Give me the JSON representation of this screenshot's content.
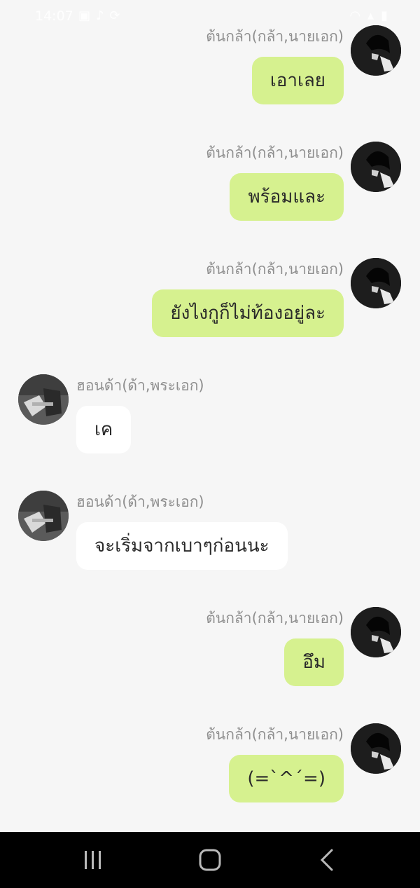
{
  "status_bar": {
    "time": "14:07",
    "icons_left": [
      "image-icon",
      "tiktok-icon",
      "sync-icon"
    ],
    "icons_right": [
      "wifi-icon",
      "signal-icon",
      "battery-icon"
    ]
  },
  "messages": [
    {
      "side": "right",
      "sender": "ต้นกล้า(กล้า,นายเอก)",
      "text": "เอาเลย"
    },
    {
      "side": "right",
      "sender": "ต้นกล้า(กล้า,นายเอก)",
      "text": "พร้อมและ"
    },
    {
      "side": "right",
      "sender": "ต้นกล้า(กล้า,นายเอก)",
      "text": "ยังไงกูก็ไม่ท้องอยู่ละ"
    },
    {
      "side": "left",
      "sender": "ฮอนด้า(ด้า,พระเอก)",
      "text": "เค"
    },
    {
      "side": "left",
      "sender": "ฮอนด้า(ด้า,พระเอก)",
      "text": "จะเริ่มจากเบาๆก่อนนะ"
    },
    {
      "side": "right",
      "sender": "ต้นกล้า(กล้า,นายเอก)",
      "text": "อึม"
    },
    {
      "side": "right",
      "sender": "ต้นกล้า(กล้า,นายเอก)",
      "text": "(=`^´=)"
    }
  ],
  "colors": {
    "background": "#f6f6f6",
    "outgoing_bubble": "#d6f18f",
    "incoming_bubble": "#ffffff",
    "sender_name": "#8f8f8f",
    "nav_bar": "#000000"
  },
  "nav": [
    "recent-apps-icon",
    "home-icon",
    "back-icon"
  ]
}
